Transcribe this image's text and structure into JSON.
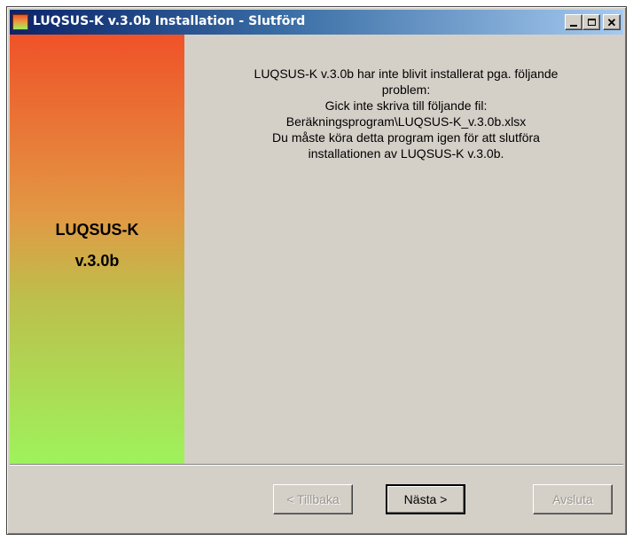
{
  "window": {
    "title": "LUQSUS-K v.3.0b Installation - Slutförd",
    "icon": "installer-app-icon",
    "controls": {
      "minimize_icon": "minimize-icon",
      "maximize_icon": "maximize-icon",
      "close_glyph": "✕"
    }
  },
  "sidebar": {
    "product_name_line1": "LUQSUS-K",
    "product_name_line2": "v.3.0b",
    "gradient_colors": [
      "#f05228",
      "#e29844",
      "#bcc04c",
      "#9ef25c"
    ]
  },
  "message": {
    "lines": [
      "LUQSUS-K v.3.0b har inte blivit installerat pga. följande",
      "problem:",
      "Gick inte skriva till följande fil:",
      "Beräkningsprogram\\LUQSUS-K_v.3.0b.xlsx",
      "Du måste köra detta program igen för att slutföra",
      "installationen av LUQSUS-K v.3.0b."
    ]
  },
  "buttons": {
    "back_label": "< Tillbaka",
    "back_enabled": false,
    "next_label": "Nästa >",
    "next_enabled": true,
    "exit_label": "Avsluta",
    "exit_enabled": false
  }
}
